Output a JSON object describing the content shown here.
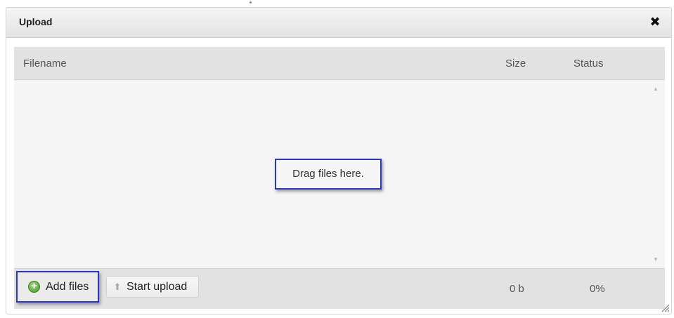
{
  "dialog": {
    "title": "Upload",
    "close_icon": "close-icon",
    "close_glyph": "✖"
  },
  "filelist": {
    "columns": {
      "filename": "Filename",
      "size": "Size",
      "status": "Status"
    },
    "drop_hint": "Drag files here.",
    "footer": {
      "add_files_label": "Add files",
      "add_files_icon": "add-circle-icon",
      "start_upload_label": "Start upload",
      "start_upload_icon": "up-arrow-icon",
      "total_size": "0 b",
      "total_status": "0%"
    }
  },
  "colors": {
    "highlight_border": "#2a37c7",
    "header_bg": "#e2e2e2",
    "list_bg": "#f5f5f5"
  }
}
